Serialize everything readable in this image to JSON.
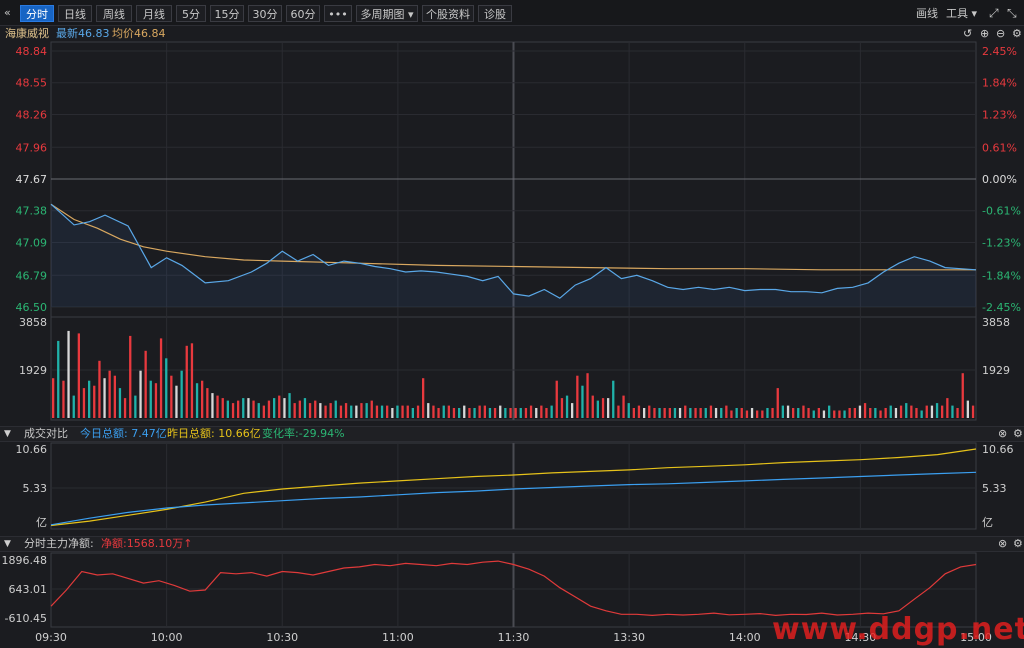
{
  "toolbar": {
    "collapse_icon": "double-chevron-left-icon",
    "tabs": [
      "分时",
      "日线",
      "周线",
      "月线",
      "5分",
      "15分",
      "30分",
      "60分",
      "•••",
      "多周期图",
      "个股资料",
      "诊股"
    ],
    "active_tab": 0,
    "right_draw": "画线",
    "right_tools": "工具",
    "expand_icon": "expand-icon",
    "restore_icon": "restore-icon"
  },
  "info": {
    "name": "海康威视",
    "latest_label": "最新",
    "latest_value": "46.83",
    "avg_label": "均价",
    "avg_value": "46.84"
  },
  "colors": {
    "price_line": "#5aa8e8",
    "avg_line": "#d9a860",
    "up": "#e8393e",
    "down": "#2bb673",
    "today_amount": "#3b9ff0",
    "yesterday_amount": "#e6c21a",
    "main_flow": "#e03a3a"
  },
  "panel_volume_bar": {
    "title": "成交对比",
    "today_label": "今日总额:",
    "today_value": "7.47亿",
    "yesterday_label": "昨日总额:",
    "yesterday_value": "10.66亿",
    "change_label": "变化率:",
    "change_value": "-29.94%"
  },
  "panel_flow_bar": {
    "title": "分时主力净额:",
    "net_label": "净额:",
    "net_value": "1568.10万",
    "arrow": "↑"
  },
  "chart_data": [
    {
      "type": "line",
      "name": "price",
      "y_ticks": [
        "48.84",
        "48.55",
        "48.26",
        "47.96",
        "47.67",
        "47.38",
        "47.09",
        "46.79",
        "46.50"
      ],
      "pct_ticks": [
        "2.45%",
        "1.84%",
        "1.23%",
        "0.61%",
        "0.00%",
        "-0.61%",
        "-1.23%",
        "-1.84%",
        "-2.45%"
      ],
      "prev_close": 47.67,
      "ylim": [
        46.5,
        48.84
      ],
      "x_ticks": [
        "09:30",
        "10:00",
        "10:30",
        "11:00",
        "11:30",
        "13:30",
        "14:00",
        "14:30",
        "15:00"
      ],
      "series": [
        {
          "x": [
            0,
            6,
            10,
            14,
            20,
            26,
            30,
            34,
            40,
            46,
            52,
            56,
            60,
            64,
            68,
            72,
            76,
            80,
            84,
            88,
            92,
            96,
            100,
            104,
            108,
            112,
            116,
            120,
            124,
            128,
            132,
            136,
            140,
            144,
            148,
            152,
            156,
            160,
            164,
            168,
            172,
            176,
            180,
            184,
            188,
            192,
            196,
            200,
            204,
            208,
            212,
            216,
            220,
            224,
            228,
            232,
            236,
            240
          ],
          "values": [
            47.44,
            47.25,
            47.28,
            47.34,
            47.24,
            46.86,
            46.95,
            46.88,
            46.72,
            46.74,
            46.82,
            46.9,
            47.01,
            46.92,
            46.98,
            46.88,
            46.92,
            46.9,
            46.87,
            46.85,
            46.82,
            46.83,
            46.82,
            46.8,
            46.78,
            46.74,
            46.78,
            46.62,
            46.6,
            46.66,
            46.58,
            46.7,
            46.76,
            46.86,
            46.76,
            46.79,
            46.74,
            46.68,
            46.66,
            46.68,
            46.66,
            46.68,
            46.65,
            46.66,
            46.66,
            46.64,
            46.64,
            46.63,
            46.67,
            46.68,
            46.72,
            46.82,
            46.9,
            46.96,
            46.92,
            46.86,
            46.85,
            46.84
          ]
        },
        {
          "x": [
            0,
            6,
            12,
            18,
            24,
            30,
            40,
            50,
            60,
            80,
            100,
            120,
            140,
            160,
            180,
            200,
            220,
            240
          ],
          "values": [
            47.44,
            47.3,
            47.22,
            47.12,
            47.05,
            47.01,
            46.96,
            46.93,
            46.92,
            46.9,
            46.88,
            46.87,
            46.86,
            46.85,
            46.85,
            46.84,
            46.84,
            46.84
          ]
        }
      ]
    },
    {
      "type": "bar",
      "name": "volume",
      "y_ticks": [
        "3858",
        "1929"
      ],
      "ylim": [
        0,
        3858
      ],
      "values": [
        1600,
        3100,
        1500,
        3500,
        900,
        3400,
        1200,
        1500,
        1300,
        2300,
        1600,
        1900,
        1700,
        1200,
        800,
        3300,
        900,
        1900,
        2700,
        1500,
        1400,
        3200,
        2400,
        1700,
        1300,
        1900,
        2900,
        3000,
        1400,
        1500,
        1200,
        1000,
        900,
        800,
        700,
        600,
        700,
        800,
        800,
        700,
        600,
        500,
        700,
        800,
        900,
        800,
        1000,
        600,
        700,
        800,
        600,
        700,
        600,
        500,
        600,
        700,
        500,
        600,
        500,
        500,
        600,
        600,
        700,
        500,
        500,
        500,
        400,
        500,
        500,
        500,
        400,
        500,
        1600,
        600,
        500,
        400,
        500,
        500,
        400,
        400,
        500,
        400,
        400,
        500,
        500,
        400,
        400,
        500,
        400,
        400,
        400,
        400,
        400,
        500,
        400,
        500,
        400,
        500,
        1500,
        800,
        900,
        600,
        1700,
        1300,
        1800,
        900,
        700,
        800,
        800,
        1500,
        500,
        900,
        600,
        400,
        500,
        400,
        500,
        400,
        400,
        400,
        400,
        400,
        400,
        500,
        400,
        400,
        400,
        400,
        500,
        400,
        400,
        500,
        300,
        400,
        400,
        300,
        400,
        300,
        300,
        400,
        400,
        1200,
        500,
        500,
        400,
        400,
        500,
        400,
        300,
        400,
        300,
        500,
        300,
        300,
        300,
        400,
        400,
        500,
        600,
        400,
        400,
        300,
        400,
        500,
        400,
        500,
        600,
        500,
        400,
        300,
        500,
        500,
        600,
        500,
        800,
        500,
        400,
        1800,
        700,
        500
      ]
    },
    {
      "type": "line",
      "name": "amount_compare",
      "y_ticks": [
        "10.66",
        "5.33",
        "亿"
      ],
      "ylim": [
        0,
        10.66
      ],
      "series": [
        {
          "color_key": "yesterday_amount",
          "x": [
            0,
            10,
            20,
            30,
            40,
            50,
            60,
            70,
            80,
            90,
            100,
            110,
            120,
            130,
            140,
            150,
            160,
            170,
            180,
            190,
            200,
            210,
            220,
            230,
            240
          ],
          "values": [
            0.2,
            0.8,
            1.6,
            2.4,
            3.4,
            4.6,
            5.2,
            5.6,
            6.0,
            6.3,
            6.6,
            6.9,
            7.1,
            7.4,
            7.6,
            7.8,
            8.1,
            8.3,
            8.5,
            8.8,
            9.0,
            9.2,
            9.5,
            9.9,
            10.66
          ]
        },
        {
          "color_key": "today_amount",
          "x": [
            0,
            10,
            20,
            30,
            40,
            50,
            60,
            70,
            80,
            90,
            100,
            110,
            120,
            130,
            140,
            150,
            160,
            170,
            180,
            190,
            200,
            210,
            220,
            230,
            240
          ],
          "values": [
            0.3,
            1.2,
            2.0,
            2.6,
            3.0,
            3.3,
            3.6,
            3.9,
            4.1,
            4.4,
            4.7,
            4.9,
            5.2,
            5.4,
            5.6,
            5.8,
            5.9,
            6.1,
            6.3,
            6.5,
            6.7,
            6.9,
            7.1,
            7.3,
            7.47
          ]
        }
      ]
    },
    {
      "type": "line",
      "name": "main_net_flow",
      "y_ticks": [
        "1896.48",
        "643.01",
        "-610.45"
      ],
      "ylim": [
        -610.45,
        1896.48
      ],
      "series": [
        {
          "color_key": "main_flow",
          "x": [
            0,
            4,
            8,
            12,
            16,
            20,
            24,
            28,
            32,
            36,
            40,
            44,
            48,
            52,
            56,
            60,
            64,
            68,
            72,
            76,
            80,
            84,
            88,
            92,
            96,
            100,
            104,
            108,
            112,
            116,
            120,
            124,
            128,
            132,
            136,
            140,
            144,
            148,
            152,
            156,
            160,
            164,
            168,
            172,
            176,
            180,
            184,
            188,
            192,
            196,
            200,
            204,
            208,
            212,
            216,
            220,
            224,
            228,
            232,
            236,
            240
          ],
          "values": [
            -100,
            600,
            1400,
            1250,
            1300,
            1100,
            900,
            1000,
            800,
            550,
            600,
            1350,
            1300,
            1350,
            1200,
            1400,
            1350,
            1250,
            1400,
            1550,
            1600,
            1700,
            1650,
            1750,
            1700,
            1650,
            1750,
            1700,
            1800,
            1850,
            1700,
            1500,
            1200,
            700,
            300,
            -100,
            -300,
            -450,
            -450,
            -500,
            -450,
            -480,
            -450,
            -400,
            -470,
            -450,
            -420,
            -500,
            -450,
            -460,
            -400,
            -480,
            -450,
            -400,
            -430,
            -300,
            200,
            700,
            1300,
            1600,
            1700
          ]
        }
      ]
    }
  ]
}
